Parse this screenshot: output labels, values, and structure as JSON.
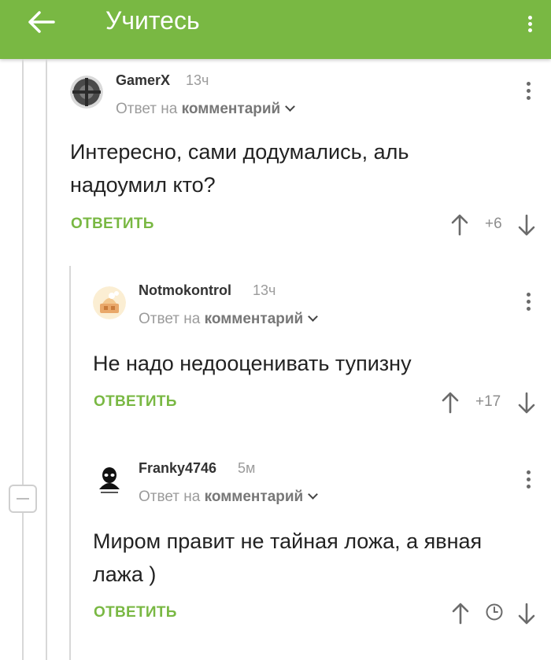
{
  "header": {
    "title": "Учитесь",
    "back_icon": "arrow-left-icon",
    "menu_icon": "more-vertical-icon",
    "color": "#79b843"
  },
  "comments": [
    {
      "author": "GamerX",
      "time": "13ч",
      "reply_prefix": "Ответ на",
      "reply_target": "комментарий",
      "text": "Интересно, сами додумались, аль надоумил кто?",
      "reply_label": "ОТВЕТИТЬ",
      "rating": "+6"
    },
    {
      "author": "Notmokontrol",
      "time": "13ч",
      "reply_prefix": "Ответ на",
      "reply_target": "комментарий",
      "text": "Не надо недооценивать тупизну",
      "reply_label": "ОТВЕТИТЬ",
      "rating": "+17"
    },
    {
      "author": "Franky4746",
      "time": "5м",
      "reply_prefix": "Ответ на",
      "reply_target": "комментарий",
      "text": "Миром правит не тайная ложа, а явная лажа )",
      "reply_label": "ОТВЕТИТЬ",
      "rating_icon": "clock-icon"
    }
  ],
  "colors": {
    "accent": "#79b843",
    "muted": "#9b9b9b",
    "thread_line": "#d8d8d8"
  }
}
